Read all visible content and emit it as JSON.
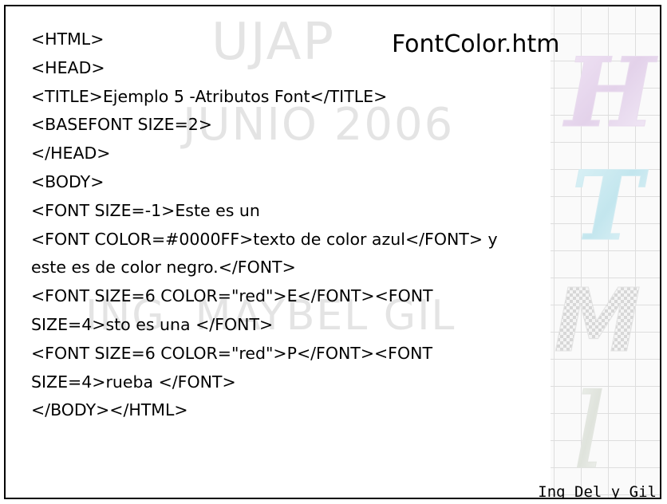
{
  "watermark": {
    "line1": "UJAP",
    "line2": "JUNIO 2006",
    "line3": "ING. MAYBEL GIL"
  },
  "title": "FontColor.htm",
  "code_lines": [
    "<HTML>",
    "<HEAD>",
    "<TITLE>Ejemplo 5 -Atributos Font</TITLE>",
    "<BASEFONT SIZE=2>",
    "</HEAD>",
    "<BODY>",
    " <FONT SIZE=-1>Este es un",
    "<FONT COLOR=#0000FF>texto de color azul</FONT> y",
    "este es de color negro.</FONT>",
    "<FONT SIZE=6 COLOR=\"red\">E</FONT><FONT",
    "SIZE=4>sto es una </FONT>",
    "<FONT SIZE=6 COLOR=\"red\">P</FONT><FONT",
    "SIZE=4>rueba </FONT>",
    "</BODY></HTML>"
  ],
  "footer": "Ing Del y Gil",
  "decoration": {
    "letters": [
      "H",
      "T",
      "M",
      "L"
    ],
    "grid_color": "#dedede",
    "watermark_color": "#e4e4e4"
  }
}
